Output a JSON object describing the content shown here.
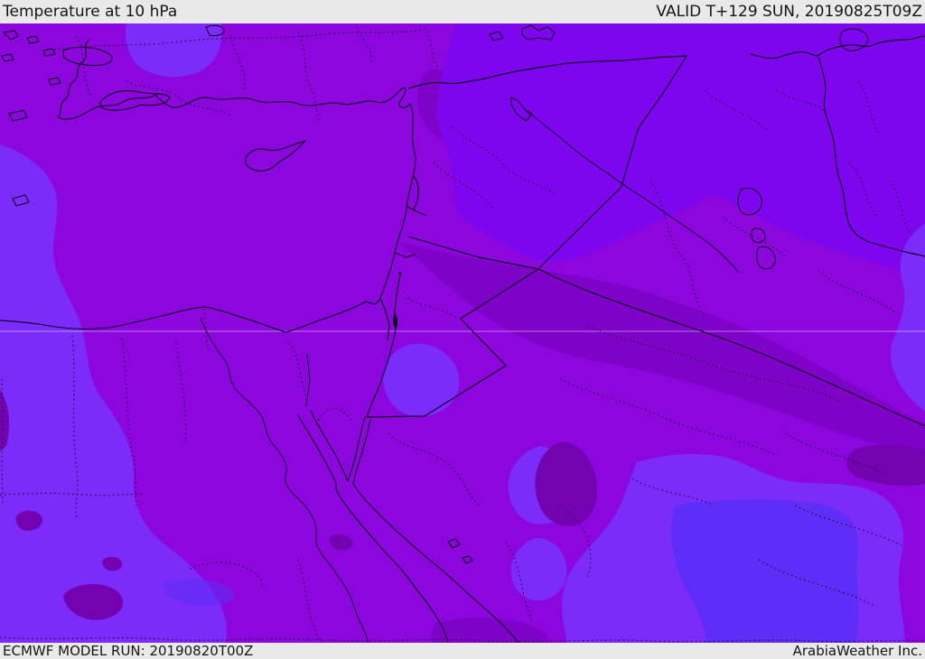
{
  "header": {
    "title": "Temperature at 10 hPa",
    "valid_label": "VALID T+129 SUN, 20190825T09Z"
  },
  "footer": {
    "model_run": "ECMWF MODEL RUN: 20190820T00Z",
    "branding": "ArabiaWeather Inc."
  },
  "map": {
    "description": "ECMWF temperature field at 10 hPa over the Middle East, purple shading with coastlines, solid country borders and dotted admin borders",
    "palette": {
      "bar_bg": "#e9e9e9",
      "bar_text": "#151515",
      "base": "#8b07dd",
      "dark_region": "#7f02c9",
      "darkest": "#7302b0",
      "ne_region": "#7e06ee",
      "bright": "#7b2cfa",
      "core": "#5e2ef8",
      "line": "#0d0118",
      "dotted": "#23042e"
    }
  }
}
